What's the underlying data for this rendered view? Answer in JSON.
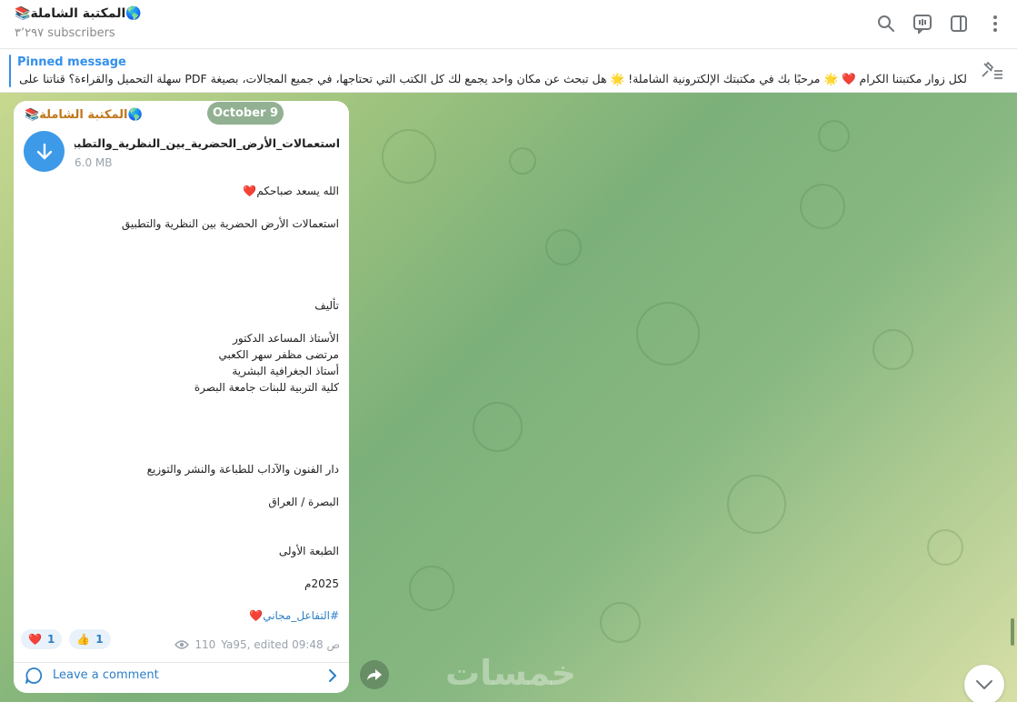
{
  "channel": {
    "title": "📚المكتبة الشاملة🌎",
    "subscribers": "٣٬٢٩٧ subscribers"
  },
  "header_icons": [
    "search-icon",
    "live-stream-icon",
    "sidebar-toggle-icon",
    "more-vertical-icon"
  ],
  "pinned": {
    "label": "Pinned message",
    "text": "لكل زوار مكتبتنا الكرام ❤️ 🌟 مرحبًا بك في مكتبتك الإلكترونية الشاملة! 🌟 هل تبحث عن مكان واحد يجمع لك كل الكتب التي تحتاجها، في جميع المجالات، بصيغة PDF سهلة التحميل والقراءة؟ قناتنا على ..."
  },
  "date_separator": "October 9",
  "message": {
    "author": "📚المكتبة الشاملة🌎",
    "file_name": "استعمالات_الأرض_الحضرية_بين_النظرية_والتطبيق_.pdf",
    "file_size": "6.0 MB",
    "lines": {
      "greeting": "الله يسعد صباحكم❤️",
      "book_title": "استعمالات الأرض الحضرية بين النظرية والتطبيق",
      "authored_by": "تأليف",
      "author_rank": "الأستاذ المساعد الدكتور",
      "author_name": "مرتضى مظفر سهر الكعبي",
      "author_field": "أستاذ الجغرافية البشرية",
      "author_college": "كلية التربية للبنات جامعة البصرة",
      "publisher": "دار الفنون والآداب للطباعة والنشر والتوزيع",
      "place": "البصرة / العراق",
      "edition": "الطبعة الأولى",
      "year": "2025م",
      "hashtag": "#التفاعل_مجاني",
      "hashtag_heart": "❤️"
    },
    "reactions": [
      {
        "emoji": "❤️",
        "count": "1"
      },
      {
        "emoji": "👍",
        "count": "1"
      }
    ],
    "views": "110",
    "edited": "Ya95, edited 09:48 ص"
  },
  "comment_label": "Leave a comment",
  "watermark": "خمسات",
  "accent": "#3390ec",
  "author_color": "#c0771a"
}
